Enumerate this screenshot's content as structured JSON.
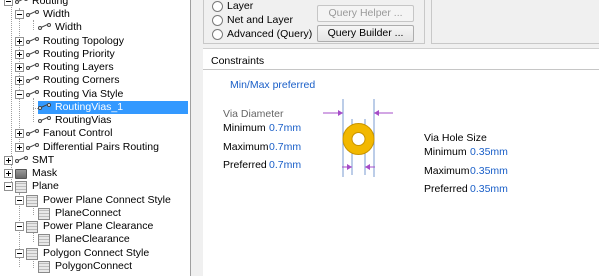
{
  "tree": {
    "items": [
      {
        "label": "Routing",
        "indent": 0
      },
      {
        "label": "Width",
        "indent": 1
      },
      {
        "label": "Width",
        "indent": 2
      },
      {
        "label": "Routing Topology",
        "indent": 1
      },
      {
        "label": "Routing Priority",
        "indent": 1
      },
      {
        "label": "Routing Layers",
        "indent": 1
      },
      {
        "label": "Routing Corners",
        "indent": 1
      },
      {
        "label": "Routing Via Style",
        "indent": 1
      },
      {
        "label": "RoutingVias_1",
        "indent": 2,
        "selected": true
      },
      {
        "label": "RoutingVias",
        "indent": 2
      },
      {
        "label": "Fanout Control",
        "indent": 1
      },
      {
        "label": "Differential Pairs Routing",
        "indent": 1
      },
      {
        "label": "SMT",
        "indent": 0
      },
      {
        "label": "Mask",
        "indent": 0
      },
      {
        "label": "Plane",
        "indent": 0
      },
      {
        "label": "Power Plane Connect Style",
        "indent": 1
      },
      {
        "label": "PlaneConnect",
        "indent": 2
      },
      {
        "label": "Power Plane Clearance",
        "indent": 1
      },
      {
        "label": "PlaneClearance",
        "indent": 2
      },
      {
        "label": "Polygon Connect Style",
        "indent": 1
      },
      {
        "label": "PolygonConnect",
        "indent": 2
      }
    ]
  },
  "query": {
    "radio_layer": "Layer",
    "radio_net_and_layer": "Net and Layer",
    "radio_advanced": "Advanced (Query)",
    "query_helper_label": "Query Helper ...",
    "query_builder_label": "Query Builder ..."
  },
  "constraints": {
    "title": "Constraints",
    "min_max_label": "Min/Max preferred",
    "via_diameter_label": "Via Diameter",
    "diameter_minimum_label": "Minimum",
    "diameter_minimum_value": "0.7mm",
    "diameter_maximum_label": "Maximum",
    "diameter_maximum_value": "0.7mm",
    "diameter_preferred_label": "Preferred",
    "diameter_preferred_value": "0.7mm",
    "via_hole_size_label": "Via Hole Size",
    "hole_minimum_label": "Minimum",
    "hole_minimum_value": "0.35mm",
    "hole_maximum_label": "Maximum",
    "hole_maximum_value": "0.35mm",
    "hole_preferred_label": "Preferred",
    "hole_preferred_value": "0.35mm"
  },
  "colors": {
    "selection": "#3399ff",
    "value_blue": "#1a5fc8",
    "via_gold": "#f2b800",
    "arrow_purple": "#a64cc8"
  }
}
